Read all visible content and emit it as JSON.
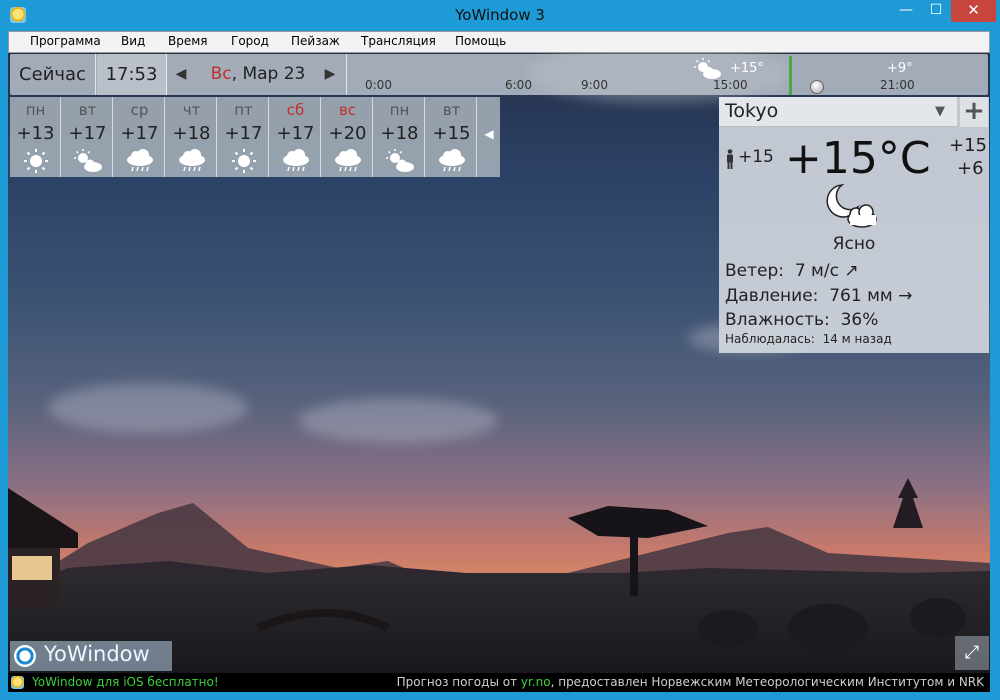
{
  "window": {
    "title": "YoWindow 3",
    "minimize": "—",
    "maximize": "☐",
    "close": "✕"
  },
  "menu": [
    "Программа",
    "Вид",
    "Время",
    "Город",
    "Пейзаж",
    "Трансляция",
    "Помощь"
  ],
  "topbar": {
    "now": "Сейчас",
    "time": "17:53",
    "day": "Вс",
    "date": ", Мар 23",
    "timeline_ticks": [
      "0:00",
      "6:00",
      "9:00",
      "15:00",
      "21:00"
    ],
    "timeline_temps": [
      "+15°",
      "+9°"
    ]
  },
  "forecast": [
    {
      "day": "пн",
      "temp": "+13",
      "weekend": false,
      "icon": "sun-icon"
    },
    {
      "day": "вт",
      "temp": "+17",
      "weekend": false,
      "icon": "sun-cloud-icon"
    },
    {
      "day": "ср",
      "temp": "+17",
      "weekend": false,
      "icon": "rain-icon"
    },
    {
      "day": "чт",
      "temp": "+18",
      "weekend": false,
      "icon": "rain-icon"
    },
    {
      "day": "пт",
      "temp": "+17",
      "weekend": false,
      "icon": "sun-icon"
    },
    {
      "day": "сб",
      "temp": "+17",
      "weekend": true,
      "icon": "rain-icon"
    },
    {
      "day": "вс",
      "temp": "+20",
      "weekend": true,
      "icon": "rain-icon"
    },
    {
      "day": "пн",
      "temp": "+18",
      "weekend": false,
      "icon": "sun-cloud-icon"
    },
    {
      "day": "вт",
      "temp": "+15",
      "weekend": false,
      "icon": "rain-icon"
    }
  ],
  "current": {
    "city": "Tokyo",
    "feels_like": "+15",
    "temperature": "+15°C",
    "high": "+15",
    "low": "+6",
    "condition": "Ясно",
    "wind_label": "Ветер:",
    "wind_value": "7 м/с ↗",
    "pressure_label": "Давление:",
    "pressure_value": "761 мм →",
    "humidity_label": "Влажность:",
    "humidity_value": "36%",
    "observed_label": "Наблюдалась:",
    "observed_value": "14 м назад"
  },
  "logo": "YoWindow",
  "status": {
    "promo": "YoWindow для iOS бесплатно!",
    "credit_prefix": "Прогноз погоды от ",
    "credit_link": "yr.no",
    "credit_suffix": ", предоставлен Норвежским Метеорологическим Институтом и NRK"
  },
  "colors": {
    "accent": "#1e9ad6",
    "weekend": "#c0302a",
    "now_marker": "#3fae3f",
    "status_link": "#3ecf3e"
  }
}
